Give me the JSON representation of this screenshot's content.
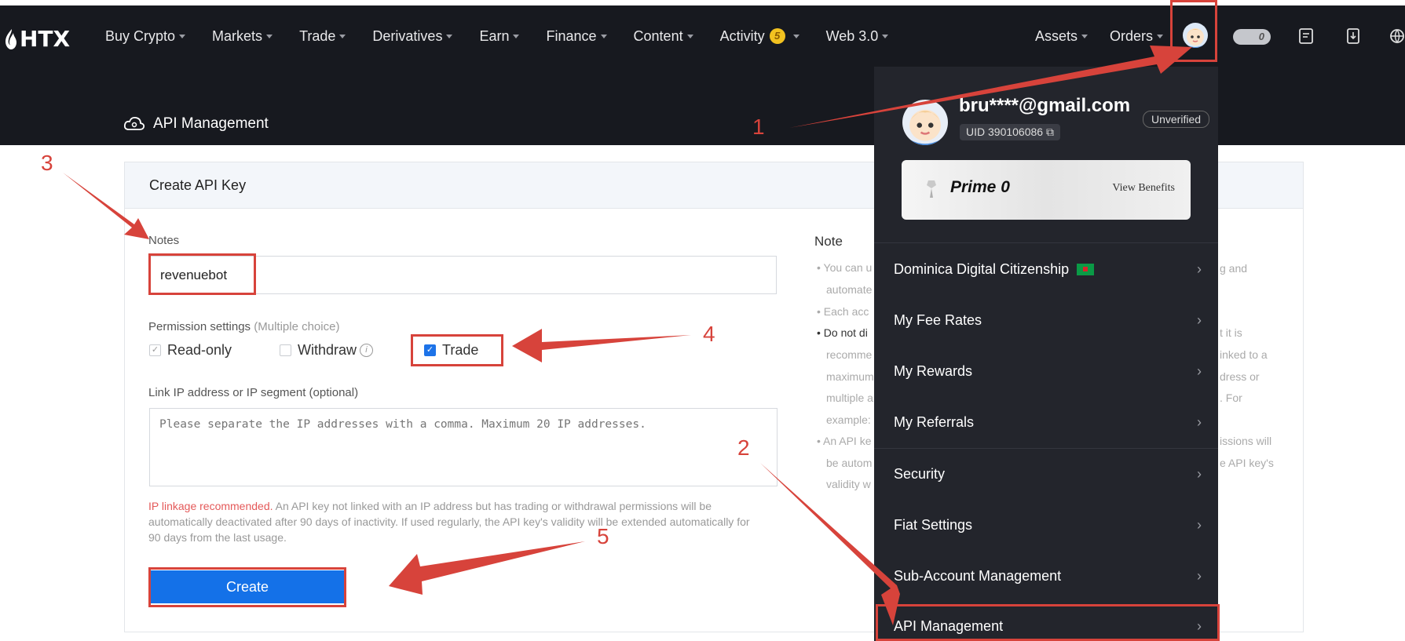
{
  "logo": {
    "text": "HTX"
  },
  "nav": {
    "items": [
      {
        "label": "Buy Crypto"
      },
      {
        "label": "Markets"
      },
      {
        "label": "Trade"
      },
      {
        "label": "Derivatives"
      },
      {
        "label": "Earn"
      },
      {
        "label": "Finance"
      },
      {
        "label": "Content"
      },
      {
        "label": "Activity",
        "badge": "5"
      },
      {
        "label": "Web 3.0"
      }
    ],
    "right": [
      {
        "label": "Assets"
      },
      {
        "label": "Orders"
      }
    ],
    "toggle_label": "0"
  },
  "page": {
    "title": "API Management"
  },
  "form": {
    "card_title": "Create API Key",
    "notes_label": "Notes",
    "notes_value": "revenuebot",
    "permission_label": "Permission settings",
    "permission_hint": "(Multiple choice)",
    "perm_readonly": "Read-only",
    "perm_withdraw": "Withdraw",
    "perm_trade": "Trade",
    "ip_label": "Link IP address or IP segment (optional)",
    "ip_placeholder": "Please separate the IP addresses with a comma. Maximum 20 IP addresses.",
    "hint_red": "IP linkage recommended.",
    "hint_rest": " An API key not linked with an IP address but has trading or withdrawal permissions will be automatically deactivated after 90 days of inactivity. If used regularly, the API key's validity will be extended automatically for 90 days from the last usage.",
    "create_label": "Create"
  },
  "note": {
    "title": "Note",
    "lines_left": [
      "• You can u",
      "automate",
      "• Each acc",
      "• Do not di",
      "recomme",
      "maximum",
      "multiple a",
      "example:",
      "• An API ke",
      "be autom",
      "validity w"
    ],
    "lines_right": [
      "g and",
      "t it is",
      "inked to a",
      "dress or",
      ". For",
      "issions will",
      "e API key's"
    ]
  },
  "dropdown": {
    "email": "bru****@gmail.com",
    "uid": "UID  390106086",
    "status": "Unverified",
    "prime": "Prime 0",
    "view_benefits": "View Benefits",
    "items": [
      {
        "label": "Dominica Digital Citizenship"
      },
      {
        "label": "My Fee Rates"
      },
      {
        "label": "My Rewards"
      },
      {
        "label": "My Referrals"
      },
      {
        "label": "Security"
      },
      {
        "label": "Fiat Settings"
      },
      {
        "label": "Sub-Account Management"
      },
      {
        "label": "API Management"
      }
    ]
  },
  "annotations": {
    "n1": "1",
    "n2": "2",
    "n3": "3",
    "n4": "4",
    "n5": "5"
  },
  "colors": {
    "accent": "#1471e8",
    "annotation": "#d7433b",
    "topbar": "#17191f"
  }
}
